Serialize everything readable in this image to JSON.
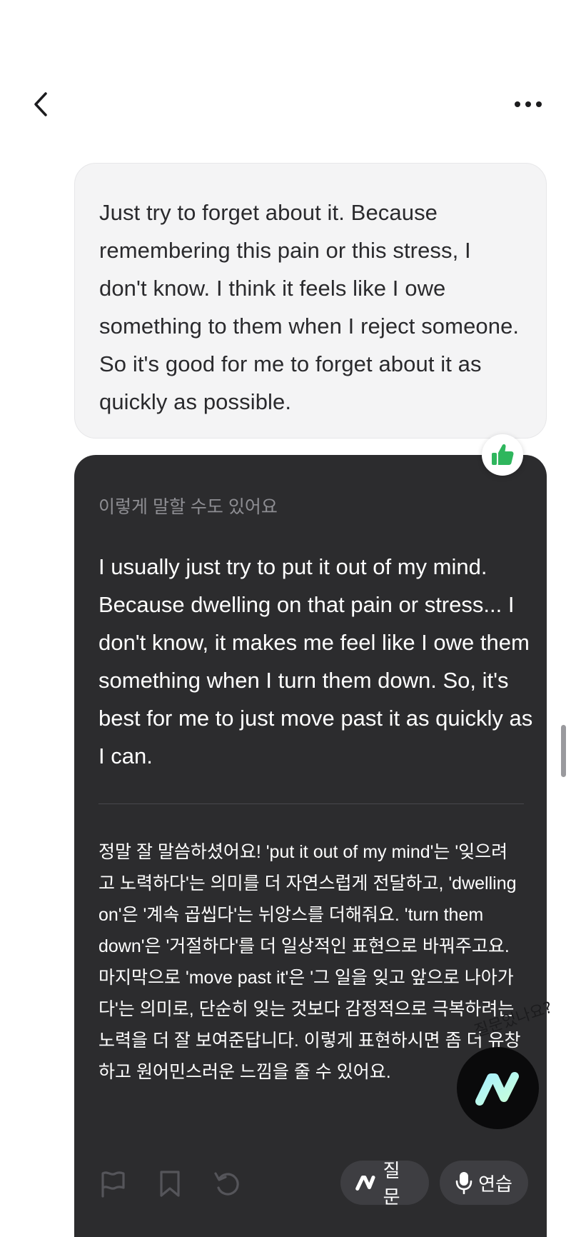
{
  "user_message": {
    "text": "Just try to forget about it. Because remembering this pain or this stress, I don't know. I think it feels like I owe something to them when I reject someone. So it's good for me to forget about it as quickly as possible."
  },
  "ai_card": {
    "caption": "이렇게 말할 수도 있어요",
    "suggestion": "I usually just try to put it out of my mind. Because dwelling on that pain or stress... I don't know, it makes me feel like I owe them something when I turn them down. So, it's best for me to just move past it as quickly as I can.",
    "explanation": "정말 잘 말씀하셨어요! 'put it out of my mind'는 '잊으려고 노력하다'는 의미를 더 자연스럽게 전달하고, 'dwelling on'은 '계속 곱씹다'는 뉘앙스를 더해줘요. 'turn them down'은 '거절하다'를 더 일상적인 표현으로 바꿔주고요. 마지막으로 'move past it'은 '그 일을 잊고 앞으로 나아가다'는 의미로, 단순히 잊는 것보다 감정적으로 극복하려는 노력을 더 잘 보여준답니다. 이렇게 표현하시면 좀 더 유창하고 원어민스러운 느낌을 줄 수 있어요.",
    "question_label": "질문",
    "practice_label": "연습"
  },
  "fab": {
    "hint": "질문있나요?"
  },
  "icons": {
    "back": "chevron-left-icon",
    "more": "more-horizontal-icon",
    "like": "thumbs-up-icon",
    "flag": "flag-icon",
    "bookmark": "bookmark-icon",
    "retry": "retry-icon",
    "question": "brand-logo-icon",
    "mic": "mic-icon"
  },
  "colors": {
    "card_bg": "#2c2c2e",
    "bubble_bg": "#f4f4f5",
    "like_green": "#2fb65d",
    "fab_gradient_start": "#a8f0ff",
    "fab_gradient_end": "#c9ffd9"
  }
}
